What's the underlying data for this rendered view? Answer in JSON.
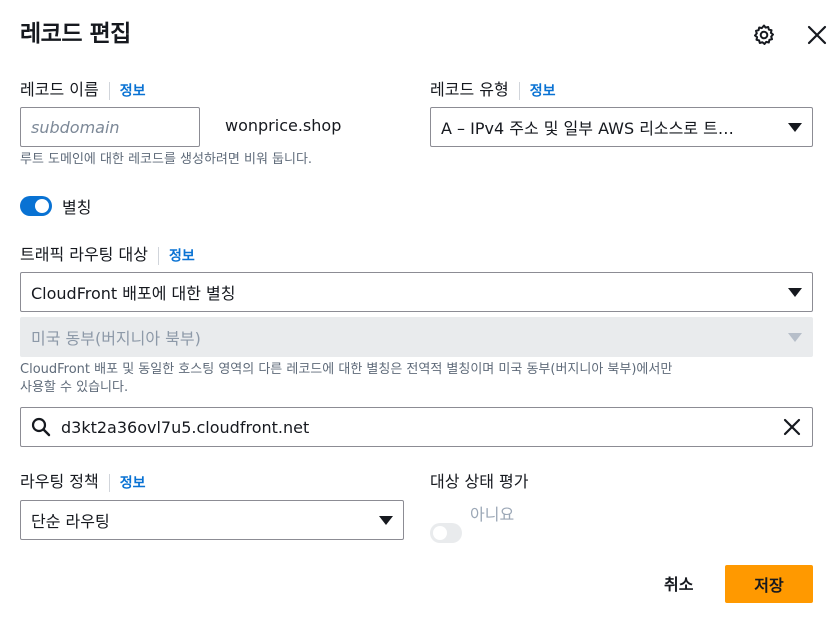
{
  "header": {
    "title": "레코드 편집",
    "settings_icon": "gear-icon",
    "close_icon": "close-icon"
  },
  "record_name": {
    "label": "레코드 이름",
    "info": "정보",
    "placeholder": "subdomain",
    "value": "",
    "domain_suffix": "wonprice.shop",
    "hint": "루트 도메인에 대한 레코드를 생성하려면 비워 둡니다."
  },
  "record_type": {
    "label": "레코드 유형",
    "info": "정보",
    "selected": "A – IPv4 주소 및 일부 AWS 리소스로 트…"
  },
  "alias": {
    "label": "별칭",
    "enabled": true,
    "color_on": "#0972d3"
  },
  "traffic_target": {
    "label": "트래픽 라우팅 대상",
    "info": "정보",
    "endpoint_selected": "CloudFront 배포에 대한 별칭",
    "region_selected": "미국 동부(버지니아 북부)",
    "hint_line1": "CloudFront 배포 및 동일한 호스팅 영역의 다른 레코드에 대한 별칭은 전역적 별칭이며 미국 동부(버지니아 북부)에서만",
    "hint_line2": "사용할 수 있습니다.",
    "search_value": "d3kt2a36ovl7u5.cloudfront.net",
    "search_icon": "search-icon",
    "clear_icon": "clear-icon"
  },
  "routing_policy": {
    "label": "라우팅 정책",
    "info": "정보",
    "selected": "단순 라우팅"
  },
  "health_check": {
    "label": "대상 상태 평가",
    "toggle_label": "아니요",
    "enabled": false
  },
  "actions": {
    "cancel": "취소",
    "save": "저장"
  },
  "colors": {
    "accent": "#0972d3",
    "primary_button": "#ff9900"
  }
}
